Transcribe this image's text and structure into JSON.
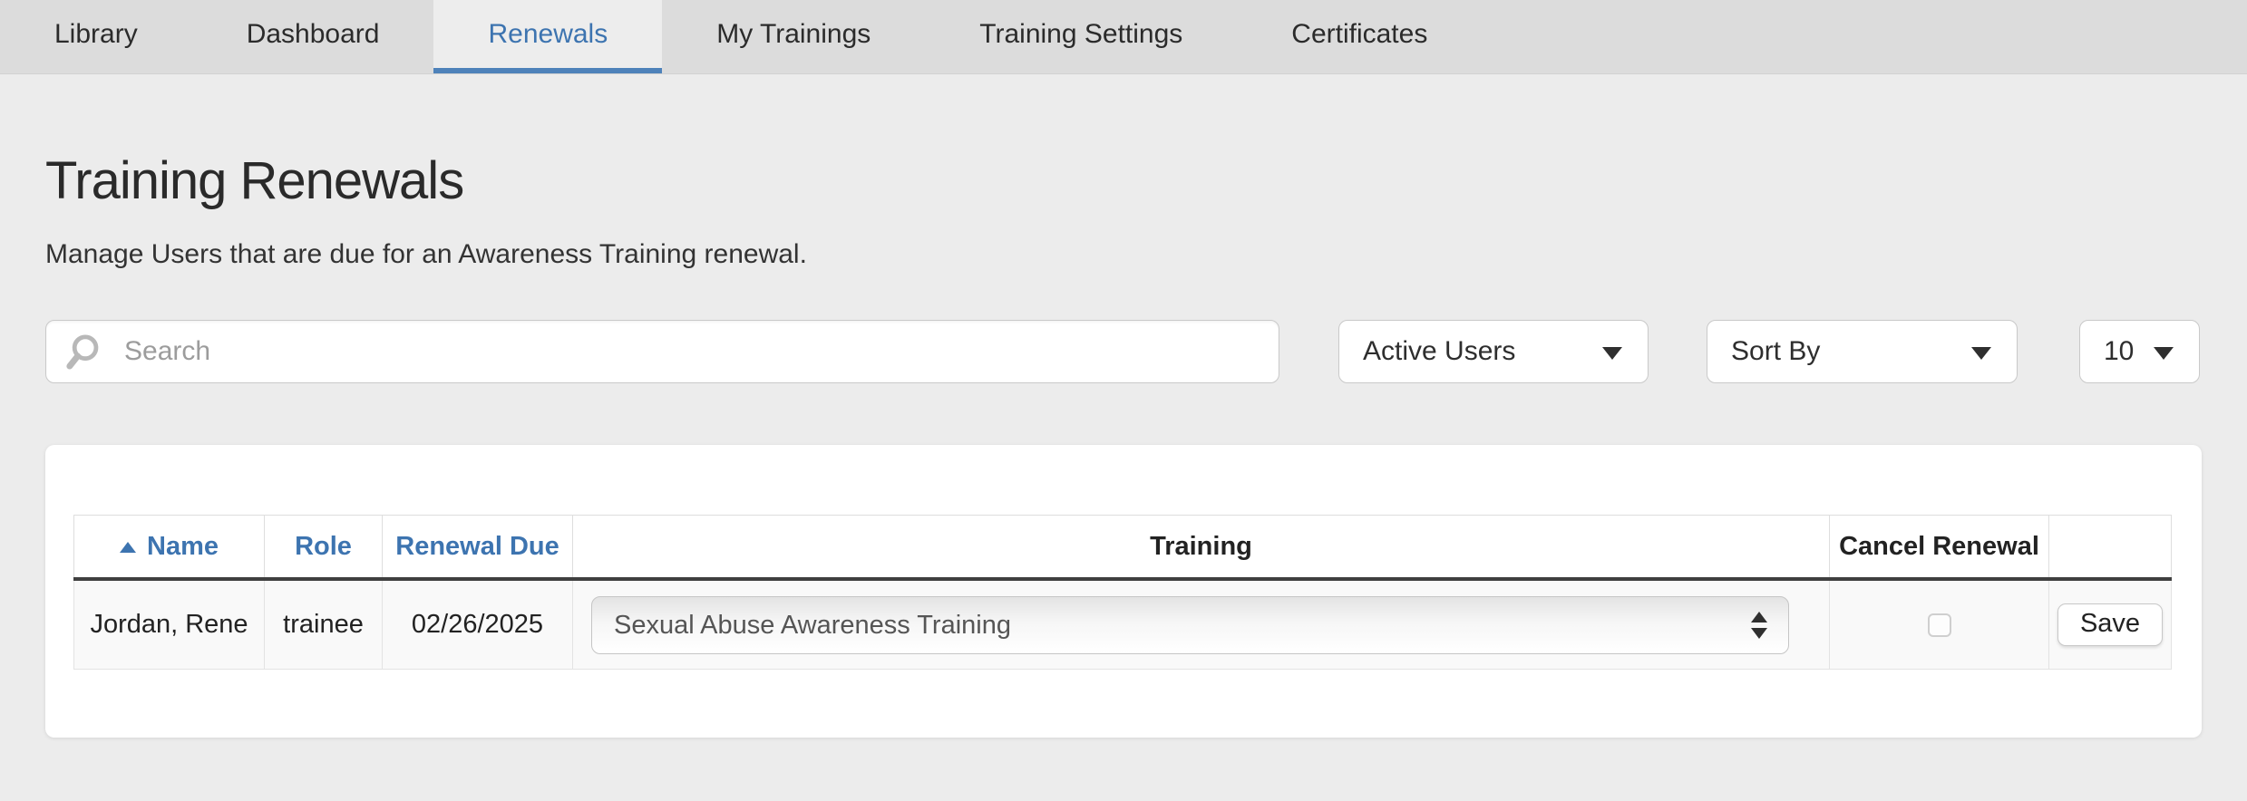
{
  "nav": {
    "tabs": [
      {
        "label": "Library"
      },
      {
        "label": "Dashboard"
      },
      {
        "label": "Renewals",
        "active": true
      },
      {
        "label": "My Trainings"
      },
      {
        "label": "Training Settings"
      },
      {
        "label": "Certificates"
      }
    ]
  },
  "page": {
    "title": "Training Renewals",
    "subtitle": "Manage Users that are due for an Awareness Training renewal."
  },
  "controls": {
    "search_placeholder": "Search",
    "user_filter_value": "Active Users",
    "sort_by_value": "Sort By",
    "page_size_value": "10"
  },
  "table": {
    "headers": [
      "Name",
      "Role",
      "Renewal Due",
      "Training",
      "Cancel Renewal",
      ""
    ],
    "rows": [
      {
        "name": "Jordan,  Rene",
        "role": "trainee",
        "renewal_due": "02/26/2025",
        "training_selected": "Sexual Abuse Awareness Training",
        "cancel_renewal_checked": false,
        "save_label": "Save"
      }
    ]
  },
  "icons": {
    "search": "magnifying-glass",
    "dropdown_caret": "caret-down",
    "name_sort": "sort-ascending-triangle",
    "select_spinner": "up-down-arrows"
  },
  "colors": {
    "accent_blue": "#3d74b0",
    "tab_underline": "#4e82ba",
    "nav_background": "#dcdcdc",
    "page_background": "#ececec",
    "header_divider": "#3f3f3f"
  }
}
